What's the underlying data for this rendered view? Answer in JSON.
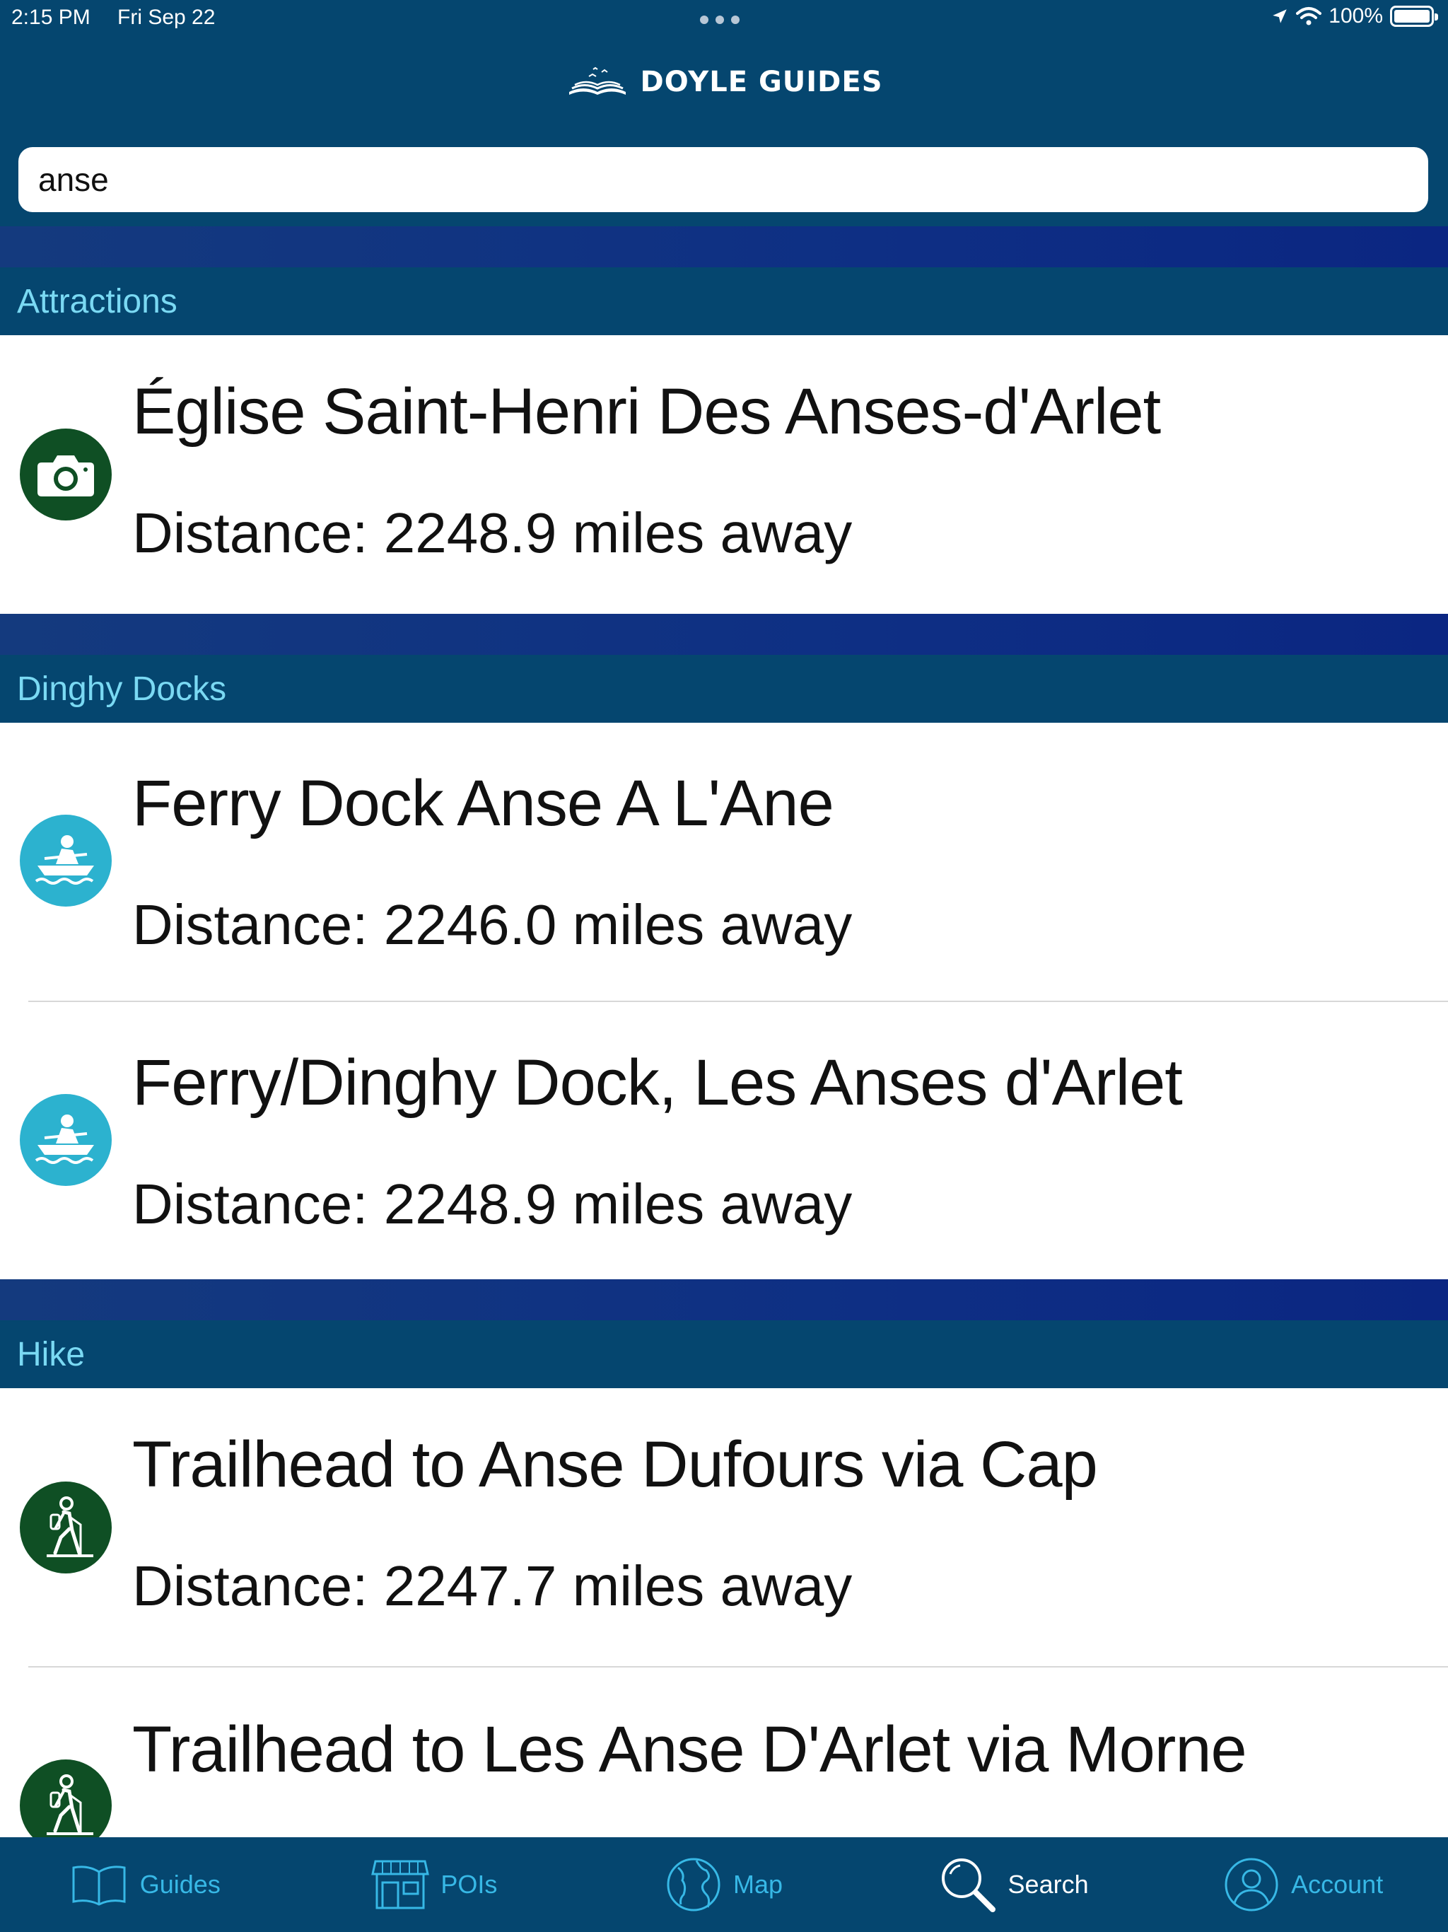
{
  "status_bar": {
    "time": "2:15 PM",
    "date": "Fri Sep 22",
    "battery": "100%"
  },
  "header": {
    "brand": "DOYLE GUIDES"
  },
  "search": {
    "value": "anse"
  },
  "sections": [
    {
      "title": "Attractions",
      "items": [
        {
          "title": "Église Saint-Henri Des Anses-d'Arlet",
          "distance": "Distance: 2248.9 miles away",
          "icon": "camera-icon"
        }
      ]
    },
    {
      "title": "Dinghy Docks",
      "items": [
        {
          "title": "Ferry Dock Anse A L'Ane",
          "distance": "Distance: 2246.0 miles away",
          "icon": "rowboat-icon"
        },
        {
          "title": "Ferry/Dinghy Dock, Les Anses d'Arlet",
          "distance": "Distance: 2248.9 miles away",
          "icon": "rowboat-icon"
        }
      ]
    },
    {
      "title": "Hike",
      "items": [
        {
          "title": "Trailhead to Anse Dufours via Cap",
          "distance": "Distance: 2247.7 miles away",
          "icon": "hiker-icon"
        },
        {
          "title": "Trailhead to Les Anse D'Arlet via Morne",
          "distance": "",
          "icon": "hiker-icon"
        }
      ]
    }
  ],
  "tabs": [
    {
      "label": "Guides",
      "icon": "book-icon"
    },
    {
      "label": "POIs",
      "icon": "storefront-icon"
    },
    {
      "label": "Map",
      "icon": "globe-icon"
    },
    {
      "label": "Search",
      "icon": "search-icon"
    },
    {
      "label": "Account",
      "icon": "user-icon"
    }
  ],
  "colors": {
    "header_bg": "#05466f",
    "section_text": "#7ad9f3",
    "band": "#0e2f84",
    "camera_icon_bg": "#0f4f24",
    "dock_icon_bg": "#2cb2cf",
    "hike_icon_bg": "#0f4f24",
    "tab_color": "#37b8e6"
  }
}
